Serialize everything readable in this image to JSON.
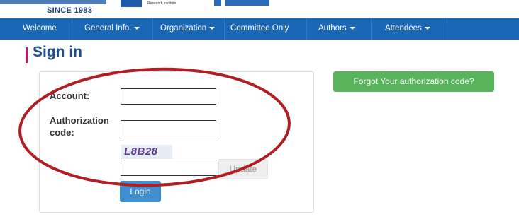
{
  "header": {
    "since_label": "SINCE 1983",
    "partner_logo_text": "Research Institute"
  },
  "nav": {
    "items": [
      {
        "label": "Welcome",
        "has_dropdown": false
      },
      {
        "label": "General Info.",
        "has_dropdown": true
      },
      {
        "label": "Organization",
        "has_dropdown": true
      },
      {
        "label": "Committee Only",
        "has_dropdown": false
      },
      {
        "label": "Authors",
        "has_dropdown": true
      },
      {
        "label": "Attendees",
        "has_dropdown": true
      }
    ]
  },
  "page": {
    "title": "Sign in"
  },
  "form": {
    "account_label": "Account:",
    "account_value": "",
    "auth_label_line1": "Authorization",
    "auth_label_line2": "code:",
    "auth_value": "",
    "captcha_text": "L8B28",
    "captcha_value": "",
    "update_label": "Update",
    "login_label": "Login"
  },
  "forgot_button_label": "Forgot Your authorization code?",
  "colors": {
    "navbar": "#1a67b5",
    "title": "#1d4f8f",
    "title_accent": "#c2186b",
    "login_button": "#3f8ed0",
    "forgot_button": "#57b45b",
    "annotation_ellipse": "#b01e22"
  }
}
